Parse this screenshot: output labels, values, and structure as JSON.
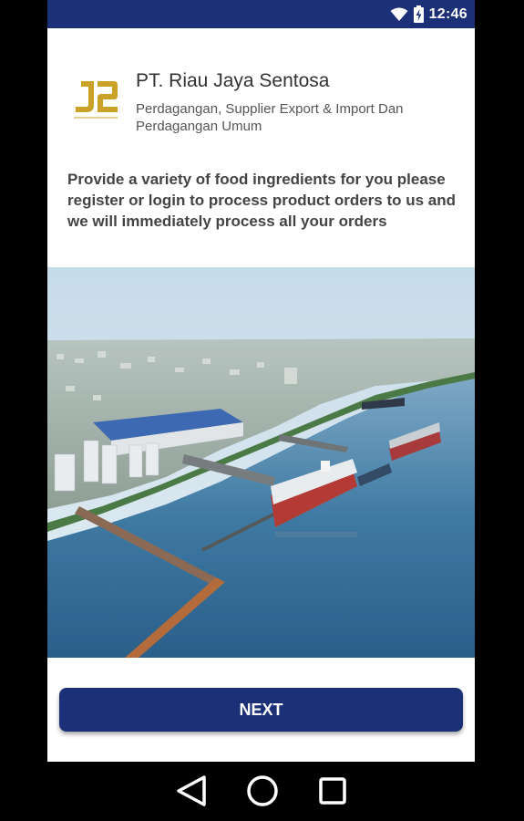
{
  "status_bar": {
    "time": "12:46",
    "icons": [
      "wifi-icon",
      "battery-charging-icon"
    ]
  },
  "header": {
    "logo_icon": "riau-jaya-sentosa-logo",
    "company_name": "PT. Riau Jaya Sentosa",
    "company_description": "Perdagangan, Supplier Export & Import Dan Perdagangan Umum"
  },
  "intro_text": "Provide a variety of food ingredients for you please register or login to process product orders to us and we will immediately process all your orders",
  "hero_image": {
    "subject": "harbor-aerial-photo"
  },
  "actions": {
    "next_label": "NEXT"
  },
  "nav_bar": {
    "icons": [
      "back-icon",
      "home-icon",
      "recents-icon"
    ]
  },
  "colors": {
    "primary": "#1c3078",
    "logo_gold": "#c9a227"
  }
}
